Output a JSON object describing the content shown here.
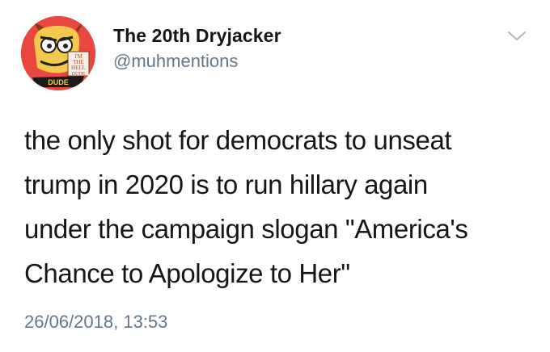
{
  "author": {
    "display_name": "The 20th Dryjacker",
    "handle": "@muhmentions",
    "avatar_text": [
      "I'M",
      "THE",
      "HELL",
      "DUDE"
    ],
    "avatar_caption": "DUDE"
  },
  "menu": {
    "icon": "chevron-down-icon"
  },
  "tweet": {
    "lines": [
      "the only shot for democrats to unseat",
      "trump in 2020 is to run hillary again",
      "under the campaign slogan \"America's",
      "Chance to Apologize to Her\""
    ],
    "timestamp": "26/06/2018, 13:53"
  },
  "colors": {
    "text": "#14171a",
    "secondary": "#657786",
    "avatar_bg": "#e8463f",
    "avatar_face": "#f2c94c"
  }
}
